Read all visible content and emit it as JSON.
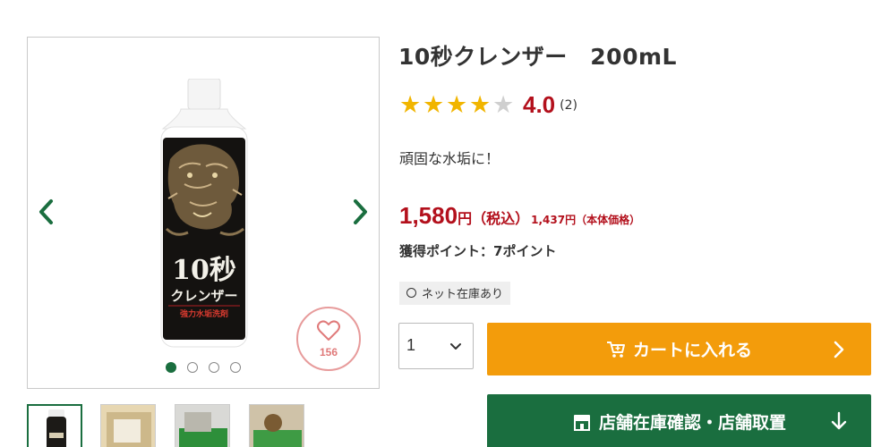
{
  "product": {
    "title": "10秒クレンザー　200mL",
    "rating_value": "4.0",
    "rating_count": "(2)",
    "rating_stars": 4,
    "tagline": "頑固な水垢に！",
    "price_amount": "1,580",
    "price_yen": "円",
    "price_tax_in": "（税込）",
    "price_net": "1,437円（本体価格）",
    "points": "獲得ポイント：7ポイント",
    "stock": "ネット在庫あり"
  },
  "gallery": {
    "favorite_count": "156",
    "slide_count": 4,
    "active_slide": 1,
    "label_big": "10秒",
    "label_name": "クレンザー",
    "label_sub": "強力水垢洗剤"
  },
  "purchase": {
    "quantity": "1",
    "cart_label": "カートに入れる",
    "store_label": "店舗在庫確認・店舗取置"
  },
  "colors": {
    "accent_green": "#1a6e3f",
    "cart_orange": "#f39c0b",
    "price_red": "#b3101c",
    "star_gold": "#f1b500"
  }
}
